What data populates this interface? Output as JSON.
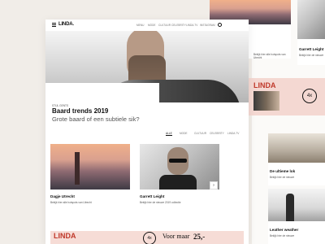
{
  "nav": {
    "logo": "LINDA.",
    "menu": [
      "MENU",
      "MODE",
      "CULTUUR",
      "CELEBRITY",
      "LINDA.TV",
      "INSTAGRAM"
    ]
  },
  "hero": {
    "category": "STIJL GENTS",
    "title": "Baard trends 2019",
    "subtitle": "Grote baard of een subtiele sik?"
  },
  "tabs": [
    "ALLE",
    "MODE",
    "CULTUUR",
    "CELEBRITY",
    "LINDA.TV"
  ],
  "cards": [
    {
      "title": "Dagje Utrecht",
      "desc": "Bekijk hier alle hotspots van Utrecht"
    },
    {
      "title": "Garrett Leight",
      "desc": "Bekijk hier de nieuwe 2019 collectie"
    }
  ],
  "promo": {
    "logo": "LINDA",
    "number": "4x",
    "text": "Voor maar",
    "price": "25,-"
  },
  "bg": {
    "top_left_desc": "Bekijk hier alle hotspots van Utrecht",
    "top_right_title": "Garrett Leight",
    "top_right_desc": "Bekijk hier de nieuwe",
    "promo_logo": "LINDA",
    "promo_number": "4x",
    "room_title": "De ultieme lok",
    "room_desc": "Bekijk hier de nieuwe",
    "leather_title": "Leather weather",
    "leather_desc": "Bekijk hier de nieuwe"
  },
  "colors": {
    "accent": "#e74c3c",
    "promo_bg": "#f4d8d2"
  }
}
